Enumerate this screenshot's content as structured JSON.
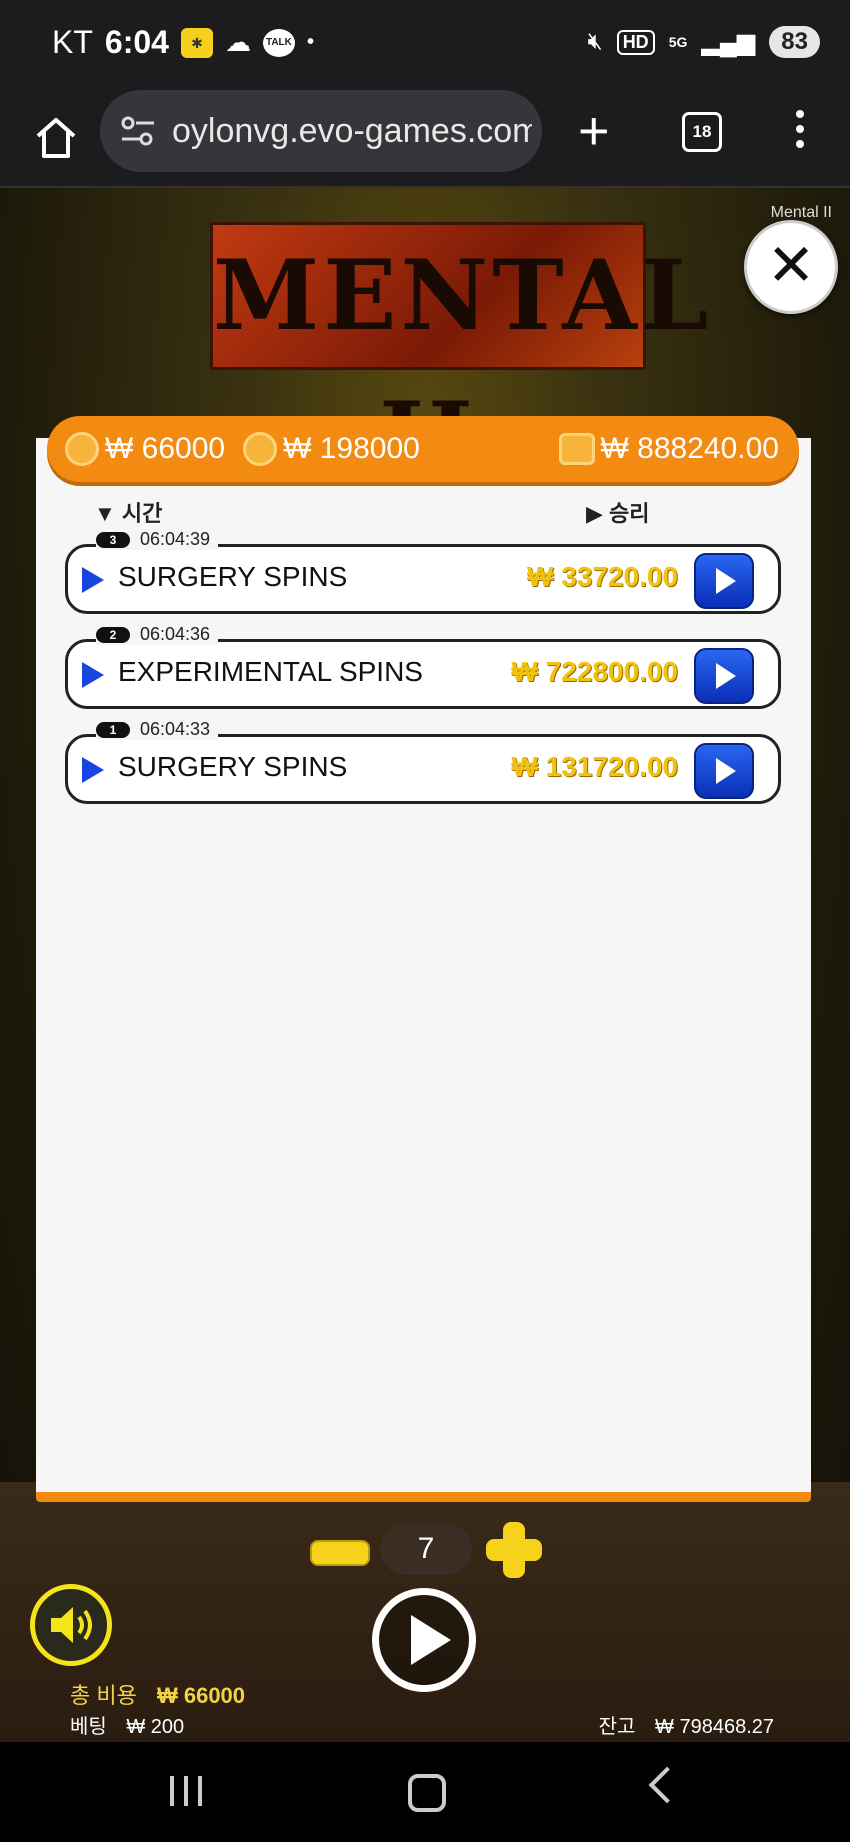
{
  "status_bar": {
    "carrier": "KT",
    "time": "6:04",
    "talk_label": "TALK",
    "network": "5G",
    "hd_label": "HD",
    "battery": "83"
  },
  "browser": {
    "url": "oylonvg.evo-games.com",
    "tab_count": "18",
    "new_tab": "+"
  },
  "game": {
    "logo_text": "MENTAL II",
    "title_small": "Mental II",
    "topbar": {
      "cost_1": "₩ 66000",
      "cost_2": "₩ 198000",
      "wallet": "₩ 888240.00"
    },
    "headers": {
      "time": "▼ 시간",
      "win": "▶ 승리"
    },
    "rows": [
      {
        "badge": "3",
        "time": "06:04:39",
        "name": "SURGERY SPINS",
        "value": "₩ 33720.00"
      },
      {
        "badge": "2",
        "time": "06:04:36",
        "name": "EXPERIMENTAL SPINS",
        "value": "₩ 722800.00"
      },
      {
        "badge": "1",
        "time": "06:04:33",
        "name": "SURGERY SPINS",
        "value": "₩ 131720.00"
      }
    ],
    "count": "7",
    "total_cost_label": "총 비용",
    "total_cost_value": "₩ 66000",
    "bet_label": "베팅",
    "bet_value": "₩ 200",
    "balance_label": "잔고",
    "balance_value": "₩ 798468.27"
  },
  "colors": {
    "accent_orange": "#f38a12",
    "play_blue": "#1a44e0",
    "win_yellow": "#f1c20e"
  }
}
